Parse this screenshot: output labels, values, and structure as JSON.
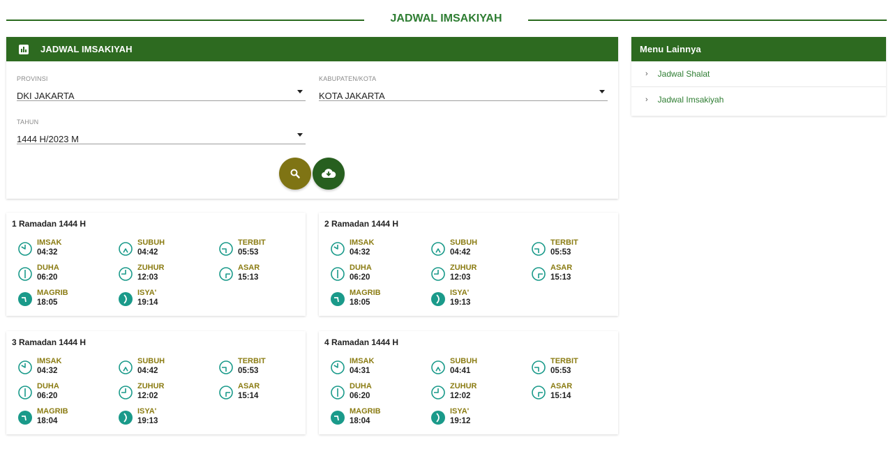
{
  "header": {
    "title": "JADWAL IMSAKIYAH"
  },
  "main_panel": {
    "title": "JADWAL IMSAKIYAH",
    "icon": "chart-icon",
    "provinsi": {
      "label": "PROVINSI",
      "value": "DKI JAKARTA"
    },
    "kabupaten": {
      "label": "KABUPATEN/KOTA",
      "value": "KOTA JAKARTA"
    },
    "tahun": {
      "label": "TAHUN",
      "value": "1444 H/2023 M"
    },
    "search_icon": "search-icon",
    "download_icon": "cloud-download-icon"
  },
  "side_menu": {
    "title": "Menu Lainnya",
    "items": [
      {
        "label": "Jadwal Shalat"
      },
      {
        "label": "Jadwal Imsakiyah"
      }
    ]
  },
  "days": [
    {
      "title": "1 Ramadan 1444 H",
      "times": [
        {
          "name": "IMSAK",
          "time": "04:32"
        },
        {
          "name": "SUBUH",
          "time": "04:42"
        },
        {
          "name": "TERBIT",
          "time": "05:53"
        },
        {
          "name": "DUHA",
          "time": "06:20"
        },
        {
          "name": "ZUHUR",
          "time": "12:03"
        },
        {
          "name": "ASAR",
          "time": "15:13"
        },
        {
          "name": "MAGRIB",
          "time": "18:05"
        },
        {
          "name": "ISYA'",
          "time": "19:14"
        }
      ]
    },
    {
      "title": "2 Ramadan 1444 H",
      "times": [
        {
          "name": "IMSAK",
          "time": "04:32"
        },
        {
          "name": "SUBUH",
          "time": "04:42"
        },
        {
          "name": "TERBIT",
          "time": "05:53"
        },
        {
          "name": "DUHA",
          "time": "06:20"
        },
        {
          "name": "ZUHUR",
          "time": "12:03"
        },
        {
          "name": "ASAR",
          "time": "15:13"
        },
        {
          "name": "MAGRIB",
          "time": "18:05"
        },
        {
          "name": "ISYA'",
          "time": "19:13"
        }
      ]
    },
    {
      "title": "3 Ramadan 1444 H",
      "times": [
        {
          "name": "IMSAK",
          "time": "04:32"
        },
        {
          "name": "SUBUH",
          "time": "04:42"
        },
        {
          "name": "TERBIT",
          "time": "05:53"
        },
        {
          "name": "DUHA",
          "time": "06:20"
        },
        {
          "name": "ZUHUR",
          "time": "12:02"
        },
        {
          "name": "ASAR",
          "time": "15:14"
        },
        {
          "name": "MAGRIB",
          "time": "18:04"
        },
        {
          "name": "ISYA'",
          "time": "19:13"
        }
      ]
    },
    {
      "title": "4 Ramadan 1444 H",
      "times": [
        {
          "name": "IMSAK",
          "time": "04:31"
        },
        {
          "name": "SUBUH",
          "time": "04:41"
        },
        {
          "name": "TERBIT",
          "time": "05:53"
        },
        {
          "name": "DUHA",
          "time": "06:20"
        },
        {
          "name": "ZUHUR",
          "time": "12:02"
        },
        {
          "name": "ASAR",
          "time": "15:14"
        },
        {
          "name": "MAGRIB",
          "time": "18:04"
        },
        {
          "name": "ISYA'",
          "time": "19:12"
        }
      ]
    }
  ],
  "colors": {
    "brand_green": "#2d6a20",
    "label_gold": "#8b7c13",
    "icon_teal": "#1a9a8a"
  }
}
